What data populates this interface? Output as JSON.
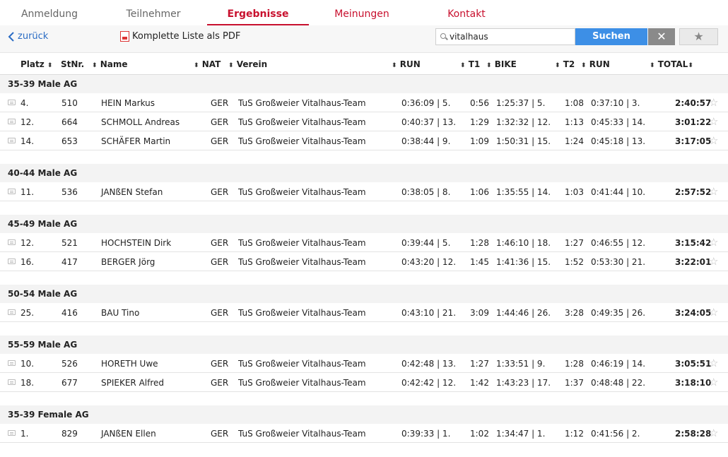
{
  "nav": {
    "tabs": [
      {
        "label": "Anmeldung"
      },
      {
        "label": "Teilnehmer"
      },
      {
        "label": "Ergebnisse"
      },
      {
        "label": "Meinungen"
      },
      {
        "label": "Kontakt"
      }
    ]
  },
  "toolbar": {
    "back_label": "zurück",
    "pdf_label": "Komplette Liste als PDF",
    "search_value": "vitalhaus",
    "search_button": "Suchen",
    "clear_button": "✕",
    "favorite_button": "★"
  },
  "table": {
    "headers": {
      "platz": "Platz",
      "stnr": "StNr.",
      "name": "Name",
      "nat": "NAT",
      "verein": "Verein",
      "run1": "RUN",
      "t1": "T1",
      "bike": "BIKE",
      "t2": "T2",
      "run2": "RUN",
      "total": "TOTAL"
    },
    "groups": [
      {
        "title": "35-39 Male AG",
        "rows": [
          {
            "platz": "4.",
            "stnr": "510",
            "name": "HEIN Markus",
            "nat": "GER",
            "verein": "TuS Großweier Vitalhaus-Team",
            "run1": "0:36:09 | 5.",
            "t1": "0:56",
            "bike": "1:25:37 | 5.",
            "t2": "1:08",
            "run2": "0:37:10 | 3.",
            "total": "2:40:57"
          },
          {
            "platz": "12.",
            "stnr": "664",
            "name": "SCHMOLL Andreas",
            "nat": "GER",
            "verein": "TuS Großweier Vitalhaus-Team",
            "run1": "0:40:37 | 13.",
            "t1": "1:29",
            "bike": "1:32:32 | 12.",
            "t2": "1:13",
            "run2": "0:45:33 | 14.",
            "total": "3:01:22"
          },
          {
            "platz": "14.",
            "stnr": "653",
            "name": "SCHÄFER Martin",
            "nat": "GER",
            "verein": "TuS Großweier Vitalhaus-Team",
            "run1": "0:38:44 | 9.",
            "t1": "1:09",
            "bike": "1:50:31 | 15.",
            "t2": "1:24",
            "run2": "0:45:18 | 13.",
            "total": "3:17:05"
          }
        ]
      },
      {
        "title": "40-44 Male AG",
        "rows": [
          {
            "platz": "11.",
            "stnr": "536",
            "name": "JANßEN Stefan",
            "nat": "GER",
            "verein": "TuS Großweier Vitalhaus-Team",
            "run1": "0:38:05 | 8.",
            "t1": "1:06",
            "bike": "1:35:55 | 14.",
            "t2": "1:03",
            "run2": "0:41:44 | 10.",
            "total": "2:57:52"
          }
        ]
      },
      {
        "title": "45-49 Male AG",
        "rows": [
          {
            "platz": "12.",
            "stnr": "521",
            "name": "HOCHSTEIN Dirk",
            "nat": "GER",
            "verein": "TuS Großweier Vitalhaus-Team",
            "run1": "0:39:44 | 5.",
            "t1": "1:28",
            "bike": "1:46:10 | 18.",
            "t2": "1:27",
            "run2": "0:46:55 | 12.",
            "total": "3:15:42"
          },
          {
            "platz": "16.",
            "stnr": "417",
            "name": "BERGER Jörg",
            "nat": "GER",
            "verein": "TuS Großweier Vitalhaus-Team",
            "run1": "0:43:20 | 12.",
            "t1": "1:45",
            "bike": "1:41:36 | 15.",
            "t2": "1:52",
            "run2": "0:53:30 | 21.",
            "total": "3:22:01"
          }
        ]
      },
      {
        "title": "50-54 Male AG",
        "rows": [
          {
            "platz": "25.",
            "stnr": "416",
            "name": "BAU Tino",
            "nat": "GER",
            "verein": "TuS Großweier Vitalhaus-Team",
            "run1": "0:43:10 | 21.",
            "t1": "3:09",
            "bike": "1:44:46 | 26.",
            "t2": "3:28",
            "run2": "0:49:35 | 26.",
            "total": "3:24:05"
          }
        ]
      },
      {
        "title": "55-59 Male AG",
        "rows": [
          {
            "platz": "10.",
            "stnr": "526",
            "name": "HORETH Uwe",
            "nat": "GER",
            "verein": "TuS Großweier Vitalhaus-Team",
            "run1": "0:42:48 | 13.",
            "t1": "1:27",
            "bike": "1:33:51 | 9.",
            "t2": "1:28",
            "run2": "0:46:19 | 14.",
            "total": "3:05:51"
          },
          {
            "platz": "18.",
            "stnr": "677",
            "name": "SPIEKER Alfred",
            "nat": "GER",
            "verein": "TuS Großweier Vitalhaus-Team",
            "run1": "0:42:42 | 12.",
            "t1": "1:42",
            "bike": "1:43:23 | 17.",
            "t2": "1:37",
            "run2": "0:48:48 | 22.",
            "total": "3:18:10"
          }
        ]
      },
      {
        "title": "35-39 Female AG",
        "rows": [
          {
            "platz": "1.",
            "stnr": "829",
            "name": "JANßEN Ellen",
            "nat": "GER",
            "verein": "TuS Großweier Vitalhaus-Team",
            "run1": "0:39:33 | 1.",
            "t1": "1:02",
            "bike": "1:34:47 | 1.",
            "t2": "1:12",
            "run2": "0:41:56 | 2.",
            "total": "2:58:28"
          }
        ]
      }
    ]
  },
  "colors": {
    "accent": "#c8102e",
    "link": "#2a6cc4",
    "button": "#3d8fe6"
  }
}
